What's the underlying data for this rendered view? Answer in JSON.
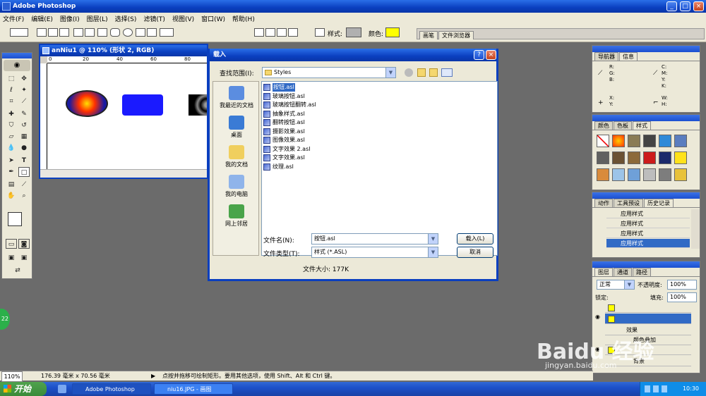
{
  "app": {
    "title": "Adobe Photoshop",
    "menu": [
      "文件(F)",
      "编辑(E)",
      "图像(I)",
      "图层(L)",
      "选择(S)",
      "滤镜(T)",
      "视图(V)",
      "窗口(W)",
      "帮助(H)"
    ],
    "options": {
      "style_label": "样式:",
      "color_label": "颜色:",
      "color_value": "#ffff00"
    },
    "panel_tabs_top": [
      "画笔",
      "文件浏览器"
    ]
  },
  "document": {
    "title": "anNiu1 @ 110% (形状 2, RGB)",
    "ruler_ticks": [
      "0",
      "20",
      "40",
      "60",
      "80"
    ]
  },
  "dialog": {
    "title": "载入",
    "look_in_label": "查找范围(I):",
    "look_in_value": "Styles",
    "places": [
      "我最近的文档",
      "桌面",
      "我的文档",
      "我的电脑",
      "网上邻居"
    ],
    "files": [
      "按钮.asl",
      "玻璃按钮.asl",
      "玻璃按钮翻转.asl",
      "抽象样式.asl",
      "翻转按钮.asl",
      "摄影效果.asl",
      "图像效果.asl",
      "文字效果 2.asl",
      "文字效果.asl",
      "纹理.asl"
    ],
    "filename_label": "文件名(N):",
    "filename_value": "按钮.asl",
    "filetype_label": "文件类型(T):",
    "filetype_value": "样式 (*.ASL)",
    "load_button": "载入(L)",
    "cancel_button": "取消",
    "filesize": "文件大小: 177K"
  },
  "navigator": {
    "tabs": [
      "导航器",
      "信息"
    ],
    "rgb": "R:\nG:\nB:",
    "cmyk": "C:\nM:\nY:\nK:",
    "xy": "X:\nY:",
    "wh": "W:\nH:"
  },
  "styles_panel": {
    "tabs": [
      "颜色",
      "色板",
      "样式"
    ]
  },
  "history_panel": {
    "tabs": [
      "动作",
      "工具预设",
      "历史记录"
    ],
    "items": [
      "应用样式",
      "应用样式",
      "应用样式",
      "应用样式"
    ]
  },
  "layers_panel": {
    "tabs": [
      "图层",
      "通道",
      "路径"
    ],
    "blend_mode": "正常",
    "opacity_label": "不透明度:",
    "opacity_value": "100%",
    "lock_label": "锁定:",
    "fill_label": "填充:",
    "fill_value": "100%",
    "effects_label": "效果",
    "effect_item": "颜色叠加",
    "bg_label": "背景"
  },
  "status": {
    "zoom": "110%",
    "size": "176.39 毫米 x 70.56 毫米",
    "hint": "点按并拖移可绘制矩形。要用其他选项，使用 Shift、Alt 和 Ctrl 键。"
  },
  "taskbar": {
    "start": "开始",
    "tasks": [
      "Adobe Photoshop",
      "niu16.JPG - 画图"
    ],
    "clock": "10:30"
  },
  "watermark": {
    "brand": "Baidu 经验",
    "url": "jingyan.baidu.com"
  }
}
